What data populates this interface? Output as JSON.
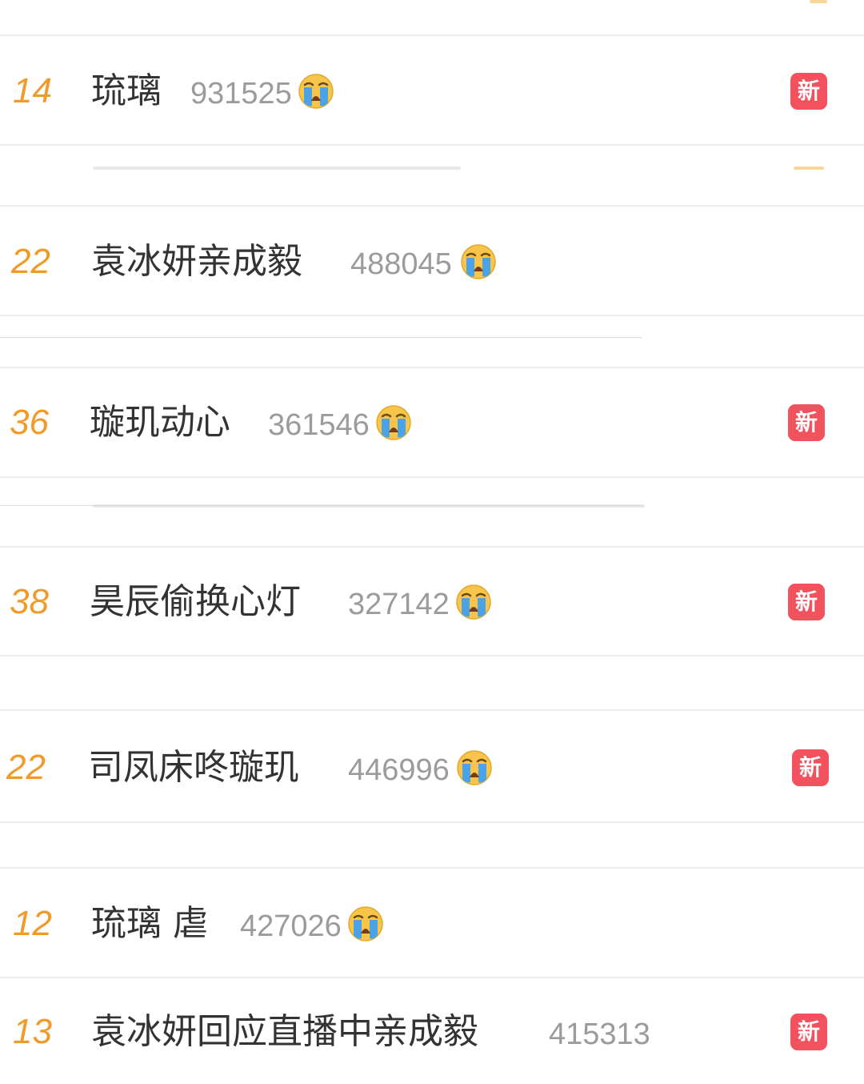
{
  "colors": {
    "rank": "#f09a2a",
    "title": "#333333",
    "count": "#9b9b9b",
    "badge_bg": "#f1525e",
    "divider": "#ececec",
    "emoji_face": "#f6c54a",
    "emoji_tears": "#4aa3e6"
  },
  "emoji_icon": "loudly-crying-face-icon",
  "rows": [
    {
      "rank": "14",
      "title": "琉璃",
      "count": "931525",
      "badge": "新"
    },
    {
      "rank": "22",
      "title": "袁冰妍亲成毅",
      "count": "488045",
      "badge": ""
    },
    {
      "rank": "36",
      "title": "璇玑动心",
      "count": "361546",
      "badge": "新"
    },
    {
      "rank": "38",
      "title": "昊辰偷换心灯",
      "count": "327142",
      "badge": "新"
    },
    {
      "rank": "22",
      "title": "司凤床咚璇玑",
      "count": "446996",
      "badge": "新"
    },
    {
      "rank": "12",
      "title": "琉璃 虐",
      "count": "427026",
      "badge": ""
    },
    {
      "rank": "13",
      "title": "袁冰妍回应直播中亲成毅",
      "count": "415313",
      "badge": "新"
    }
  ]
}
